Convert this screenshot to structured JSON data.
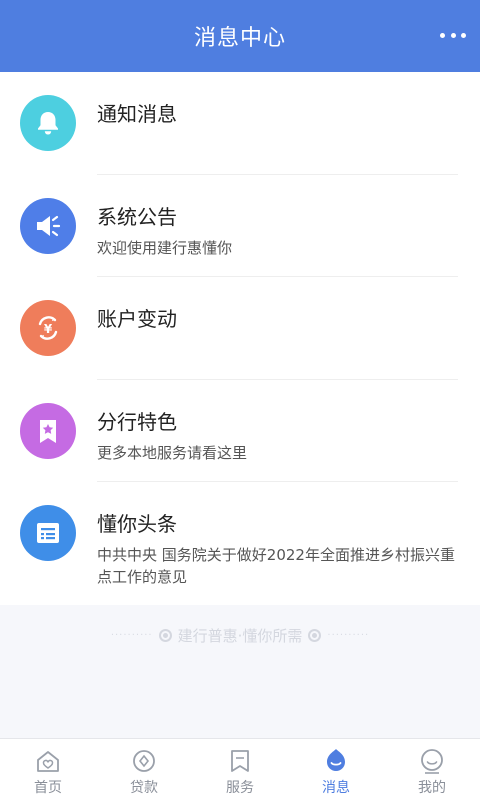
{
  "header": {
    "title": "消息中心"
  },
  "items": [
    {
      "title": "通知消息",
      "subtitle": "",
      "icon": "bell-icon",
      "color": "#4dcfe0"
    },
    {
      "title": "系统公告",
      "subtitle": "欢迎使用建行惠懂你",
      "icon": "megaphone-icon",
      "color": "#4f7ee8"
    },
    {
      "title": "账户变动",
      "subtitle": "",
      "icon": "yuan-exchange-icon",
      "color": "#ef7d5b"
    },
    {
      "title": "分行特色",
      "subtitle": "更多本地服务请看这里",
      "icon": "star-ribbon-icon",
      "color": "#c56be3"
    },
    {
      "title": "懂你头条",
      "subtitle": "中共中央 国务院关于做好2022年全面推进乡村振兴重点工作的意见",
      "icon": "news-icon",
      "color": "#3f8ee8"
    }
  ],
  "slogan": "建行普惠·懂你所需",
  "tabs": [
    {
      "label": "首页",
      "icon": "home-icon"
    },
    {
      "label": "贷款",
      "icon": "loan-icon"
    },
    {
      "label": "服务",
      "icon": "service-icon"
    },
    {
      "label": "消息",
      "icon": "message-icon",
      "active": true
    },
    {
      "label": "我的",
      "icon": "profile-icon"
    }
  ],
  "colors": {
    "accent": "#4f7ee0",
    "tab_inactive": "#8a8f99"
  }
}
